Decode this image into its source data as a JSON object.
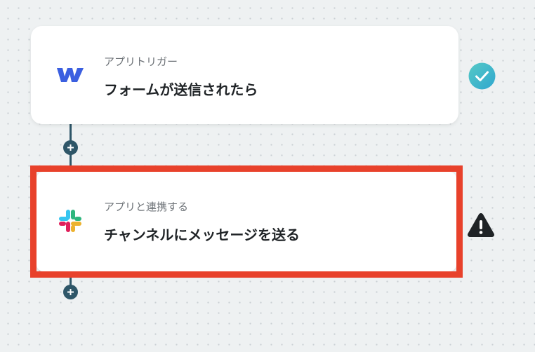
{
  "flow": {
    "steps": [
      {
        "subtitle": "アプリトリガー",
        "title": "フォームが送信されたら",
        "app_icon": "webflow-logo-icon",
        "status_icon": "check-circle-icon",
        "status": "complete"
      },
      {
        "subtitle": "アプリと連携する",
        "title": "チャンネルにメッセージを送る",
        "app_icon": "slack-logo-icon",
        "status_icon": "warning-triangle-icon",
        "status": "warning"
      }
    ],
    "add_step_icon": "plus-icon"
  },
  "colors": {
    "accent": "#2e5668",
    "check": "#3bb8c9",
    "warning": "#1f2326",
    "highlight": "#e8412b",
    "webflow": "#3b5fe0"
  }
}
